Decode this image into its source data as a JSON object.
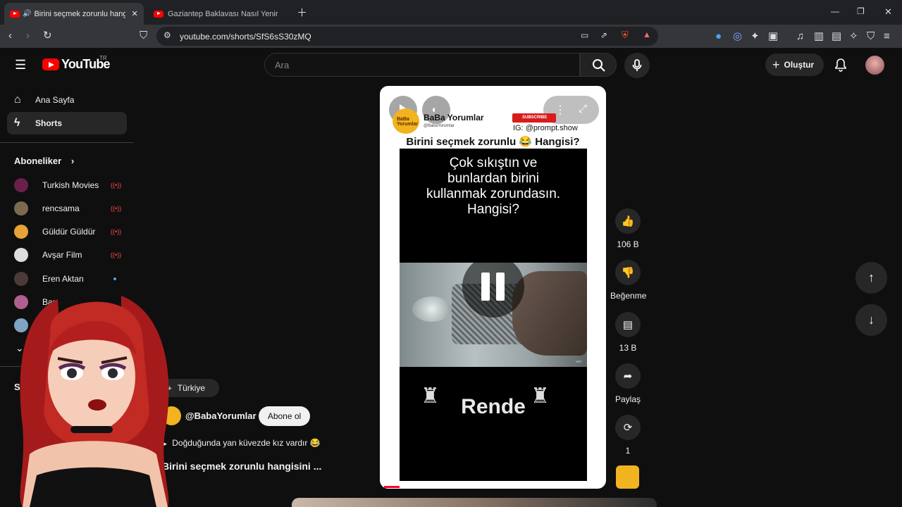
{
  "browser": {
    "tabs": [
      {
        "title": "Birini seçmek zorunlu hangisi",
        "active": true
      },
      {
        "title": "Gaziantep Baklavası Nasıl Yenir ? - Ke",
        "active": false
      }
    ],
    "url": "youtube.com/shorts/SfS6sS30zMQ"
  },
  "header": {
    "logo": "YouTube",
    "country": "TR",
    "search_placeholder": "Ara",
    "create_label": "Oluştur"
  },
  "sidebar": {
    "items": [
      {
        "label": "Ana Sayfa",
        "icon": "home-icon"
      },
      {
        "label": "Shorts",
        "icon": "shorts-icon"
      }
    ],
    "subscriptions_title": "Aboneliker",
    "channels": [
      {
        "name": "Turkish Movies",
        "status": "live",
        "color": "#6b1f4d"
      },
      {
        "name": "rencsama",
        "status": "live",
        "color": "#7b6a4e"
      },
      {
        "name": "Güldür Güldür",
        "status": "live",
        "color": "#e8a23a"
      },
      {
        "name": "Avşar Film",
        "status": "live",
        "color": "#dddddd"
      },
      {
        "name": "Eren Aktan",
        "status": "new",
        "color": "#4a3b38"
      },
      {
        "name": "Bar",
        "status": "",
        "color": "#b06090"
      },
      {
        "name": "",
        "status": "",
        "color": "#7fa3c4"
      }
    ],
    "you_title": "Siz"
  },
  "short": {
    "channel_name": "BaBa Yorumlar",
    "channel_handle_small": "@BabaYorumlar",
    "subscribe_badge": "SUBSCRIBE",
    "instagram": "IG: @prompt.show",
    "title": "Birini seçmek zorunlu 😂 Hangisi?",
    "video_text": [
      "Çok sıkıştın ve",
      "bunlardan birini",
      "kullanmak zorundasın.",
      "Hangisi?"
    ],
    "answer": "Rende",
    "watermark": "veo"
  },
  "actions": {
    "likes": "106 B",
    "dislike_label": "Beğenme",
    "comments": "13 B",
    "share_label": "Paylaş",
    "remix_count": "1"
  },
  "info": {
    "location": "Türkiye",
    "handle": "@BabaYorumlar",
    "subscribe_label": "Abone ol",
    "song": "Doğduğunda yan küvezde kız vardır 😂",
    "description": "Birini seçmek zorunlu hangisini ..."
  },
  "colors": {
    "accent": "#ff0000",
    "bg": "#0f0f0f",
    "panel": "#272727"
  }
}
